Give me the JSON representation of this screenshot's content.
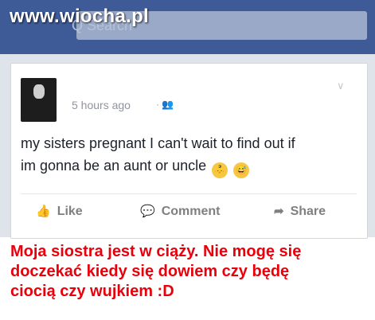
{
  "watermark": "www.wiocha.pl",
  "search": {
    "ghost": "Q Search"
  },
  "post": {
    "timestamp": "5 hours ago",
    "audience_sep": "·",
    "text_line1": "my sisters pregnant I can't wait to find out if",
    "text_line2": "im gonna be an aunt or uncle",
    "emoji_1": "baby-face",
    "emoji_2": "grinning-sweat-face"
  },
  "actions": {
    "like": "Like",
    "comment": "Comment",
    "share": "Share"
  },
  "caption": {
    "line1": "Moja siostra jest w ciąży. Nie mogę się",
    "line2": "doczekać kiedy się dowiem czy będę",
    "line3": "ciocią czy wujkiem :D"
  },
  "colors": {
    "facebook_blue": "#3e5b98",
    "caption_red": "#e8000b"
  }
}
